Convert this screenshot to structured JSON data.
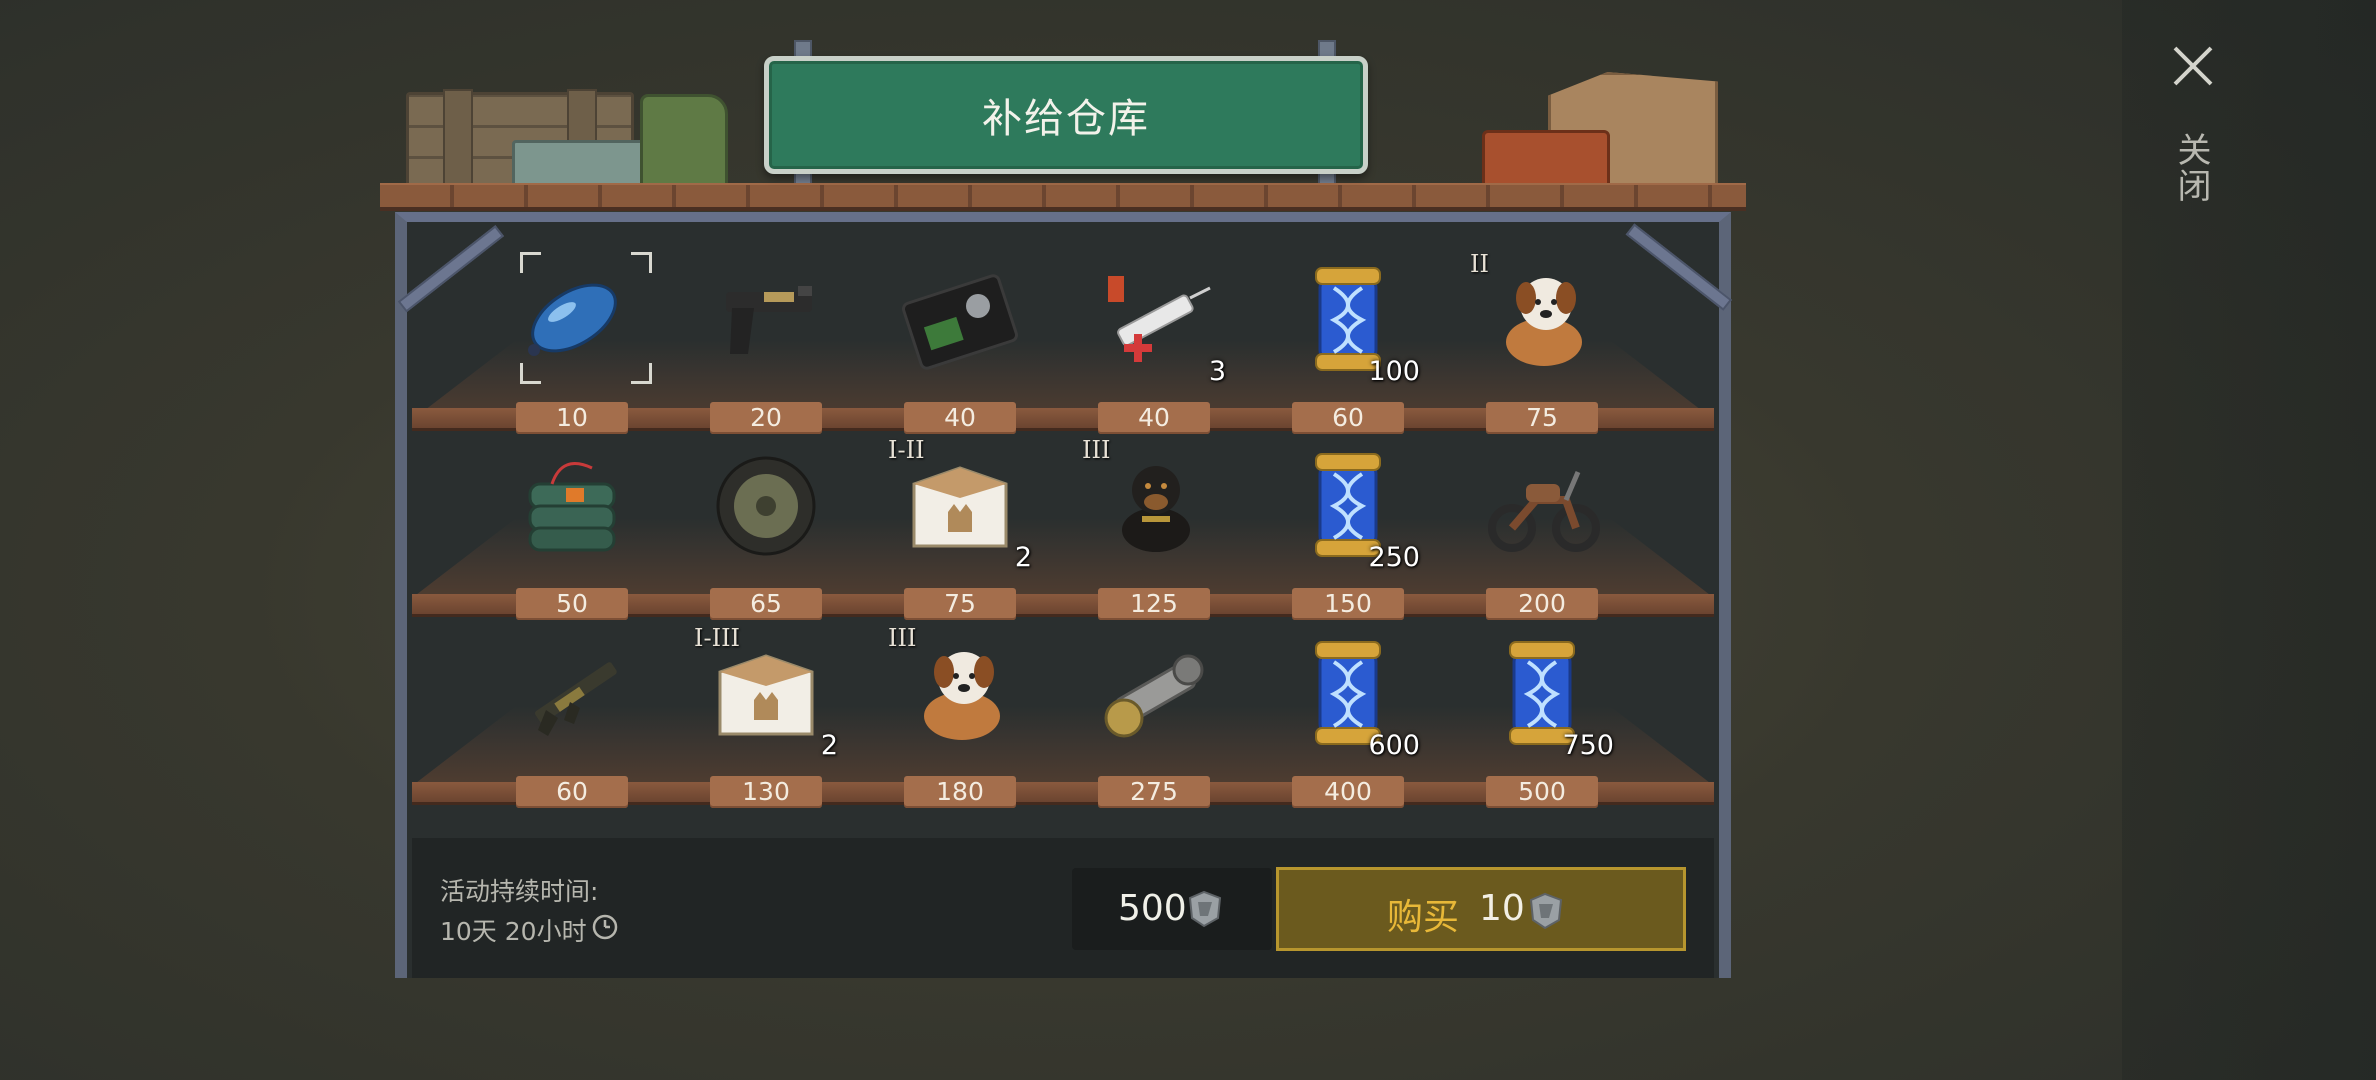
{
  "title": "补给仓库",
  "close": {
    "label": "关闭"
  },
  "shelves": [
    {
      "items": [
        {
          "name": "Blue fuel tank",
          "icon": "fuel-tank-icon",
          "price": "10",
          "qty": "",
          "tier": "",
          "selected": true
        },
        {
          "name": "Pistol",
          "icon": "pistol-icon",
          "price": "20",
          "qty": "",
          "tier": "",
          "selected": false
        },
        {
          "name": "Badge wallet",
          "icon": "badge-wallet-icon",
          "price": "40",
          "qty": "",
          "tier": "",
          "selected": false
        },
        {
          "name": "Syringe",
          "icon": "syringe-icon",
          "price": "40",
          "qty": "3",
          "tier": "",
          "selected": false
        },
        {
          "name": "DNA capsule",
          "icon": "dna-capsule-icon",
          "price": "60",
          "qty": "100",
          "tier": "",
          "selected": false
        },
        {
          "name": "Saint Bernard dog",
          "icon": "saint-bernard-dog-icon",
          "price": "75",
          "qty": "",
          "tier": "II",
          "selected": false
        }
      ]
    },
    {
      "items": [
        {
          "name": "Explosive bundle",
          "icon": "explosive-bundle-icon",
          "price": "50",
          "qty": "",
          "tier": "",
          "selected": false
        },
        {
          "name": "Wheel",
          "icon": "wheel-icon",
          "price": "65",
          "qty": "",
          "tier": "",
          "selected": false
        },
        {
          "name": "Cat crate",
          "icon": "cat-crate-icon",
          "price": "75",
          "qty": "2",
          "tier": "I-II",
          "selected": false
        },
        {
          "name": "Rottweiler dog",
          "icon": "rottweiler-dog-icon",
          "price": "125",
          "qty": "",
          "tier": "III",
          "selected": false
        },
        {
          "name": "DNA capsule",
          "icon": "dna-capsule-icon",
          "price": "150",
          "qty": "250",
          "tier": "",
          "selected": false
        },
        {
          "name": "Motorcycle",
          "icon": "motorcycle-icon",
          "price": "200",
          "qty": "",
          "tier": "",
          "selected": false
        }
      ]
    },
    {
      "items": [
        {
          "name": "Assault rifle",
          "icon": "rifle-icon",
          "price": "60",
          "qty": "",
          "tier": "",
          "selected": false
        },
        {
          "name": "Cat crate",
          "icon": "cat-crate-icon",
          "price": "130",
          "qty": "2",
          "tier": "I-III",
          "selected": false
        },
        {
          "name": "Saint Bernard dog",
          "icon": "saint-bernard-dog-icon",
          "price": "180",
          "qty": "",
          "tier": "III",
          "selected": false
        },
        {
          "name": "Drive shaft",
          "icon": "drive-shaft-icon",
          "price": "275",
          "qty": "",
          "tier": "",
          "selected": false
        },
        {
          "name": "DNA capsule",
          "icon": "dna-capsule-icon",
          "price": "400",
          "qty": "600",
          "tier": "",
          "selected": false
        },
        {
          "name": "DNA capsule",
          "icon": "dna-capsule-icon",
          "price": "500",
          "qty": "750",
          "tier": "",
          "selected": false
        }
      ]
    }
  ],
  "event": {
    "duration_label": "活动持续时间:",
    "duration_value": "10天 20小时"
  },
  "balance": {
    "value": "500",
    "currency_icon": "token-icon"
  },
  "buy": {
    "label": "购买",
    "cost": "10",
    "currency_icon": "token-icon"
  },
  "colors": {
    "sign": "#2e7a5c",
    "price_tag": "#a46e4c",
    "buy_button": "#6b5a1e",
    "buy_text": "#e8b838"
  }
}
